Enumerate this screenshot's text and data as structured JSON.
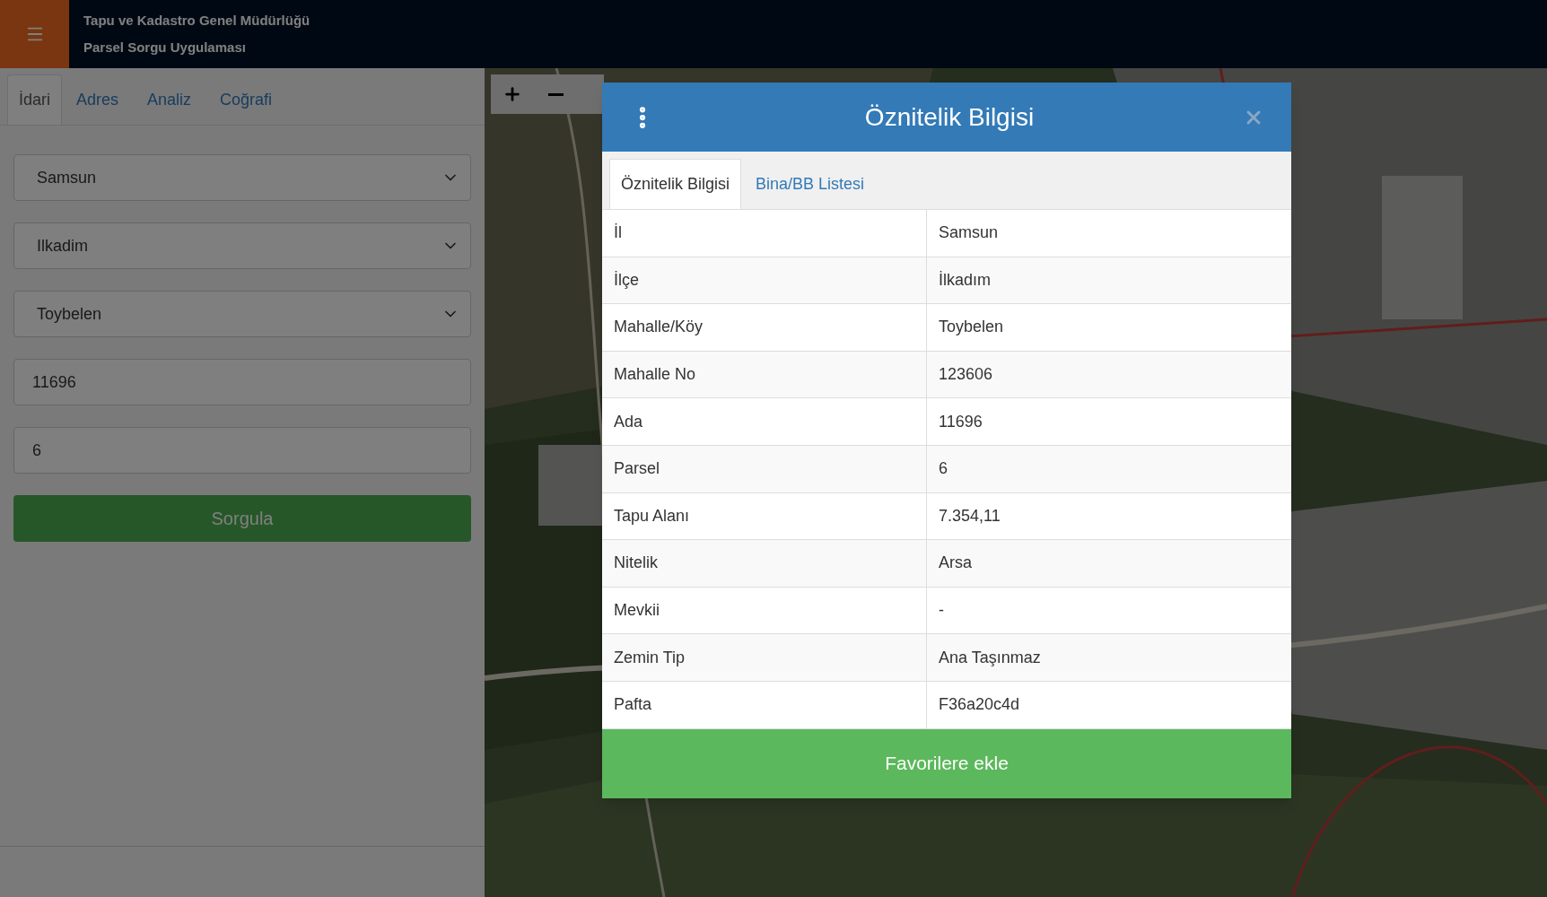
{
  "header": {
    "title": "Tapu ve Kadastro Genel Müdürlüğü",
    "subtitle": "Parsel Sorgu Uygulaması"
  },
  "sidebar": {
    "tabs": [
      {
        "label": "İdari",
        "selected": true
      },
      {
        "label": "Adres",
        "selected": false
      },
      {
        "label": "Analiz",
        "selected": false
      },
      {
        "label": "Coğrafi",
        "selected": false
      }
    ],
    "fields": [
      {
        "kind": "select",
        "value": "Samsun"
      },
      {
        "kind": "select",
        "value": "Ilkadim"
      },
      {
        "kind": "select",
        "value": "Toybelen"
      },
      {
        "kind": "input",
        "value": "11696"
      },
      {
        "kind": "input",
        "value": "6"
      }
    ],
    "submit": "Sorgula"
  },
  "modal": {
    "title": "Öznitelik Bilgisi",
    "tabs": [
      {
        "label": "Öznitelik Bilgisi",
        "selected": true
      },
      {
        "label": "Bina/BB Listesi",
        "selected": false
      }
    ],
    "rows": [
      {
        "label": "İl",
        "value": "Samsun"
      },
      {
        "label": "İlçe",
        "value": "İlkadım"
      },
      {
        "label": "Mahalle/Köy",
        "value": "Toybelen"
      },
      {
        "label": "Mahalle No",
        "value": "123606"
      },
      {
        "label": "Ada",
        "value": "11696"
      },
      {
        "label": "Parsel",
        "value": "6"
      },
      {
        "label": "Tapu Alanı",
        "value": "7.354,11"
      },
      {
        "label": "Nitelik",
        "value": "Arsa"
      },
      {
        "label": "Mevkii",
        "value": "-"
      },
      {
        "label": "Zemin Tip",
        "value": "Ana Taşınmaz"
      },
      {
        "label": "Pafta",
        "value": "F36a20c4d"
      }
    ],
    "button": "Favorilere ekle"
  }
}
